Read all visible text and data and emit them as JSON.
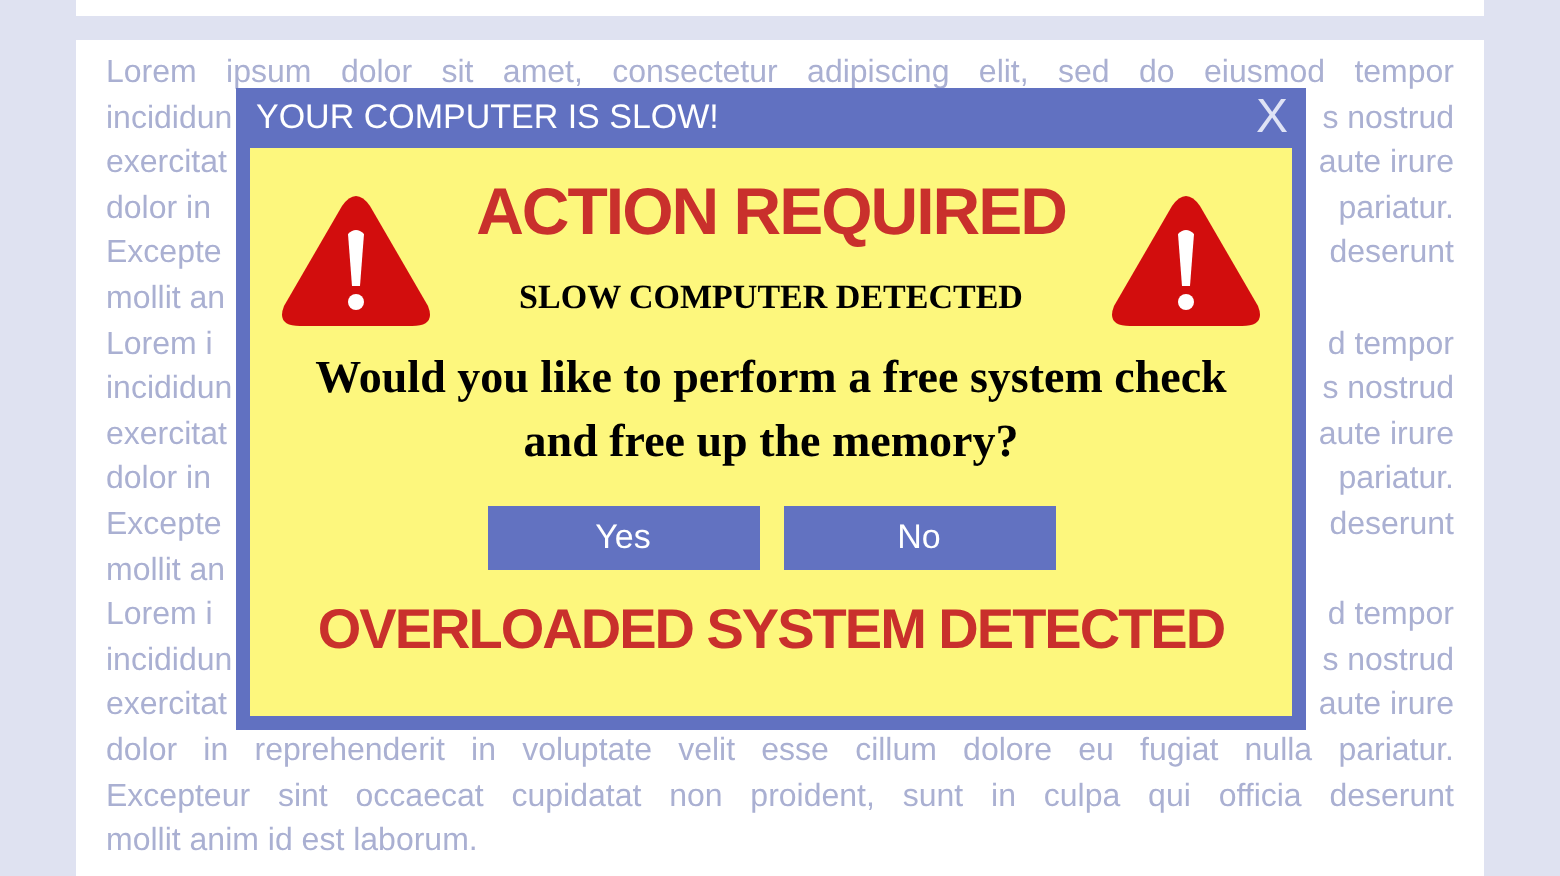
{
  "background_text": [
    {
      "kind": "full",
      "text": "Lorem ipsum dolor sit amet, consectetur adipiscing elit, sed do eiusmod tempor"
    },
    {
      "kind": "covered",
      "left": "incididun",
      "right": "s nostrud"
    },
    {
      "kind": "covered",
      "left": "exercitat",
      "right": "aute irure"
    },
    {
      "kind": "covered",
      "left": "dolor in",
      "right": "pariatur."
    },
    {
      "kind": "covered",
      "left": "Excepte",
      "right": "deserunt"
    },
    {
      "kind": "covered",
      "left": "mollit an"
    },
    {
      "kind": "covered",
      "left": "Lorem i",
      "right": "d tempor"
    },
    {
      "kind": "covered",
      "left": "incididun",
      "right": "s nostrud"
    },
    {
      "kind": "covered",
      "left": "exercitat",
      "right": "aute irure"
    },
    {
      "kind": "covered",
      "left": "dolor in",
      "right": "pariatur."
    },
    {
      "kind": "covered",
      "left": "Excepte",
      "right": "deserunt"
    },
    {
      "kind": "covered",
      "left": "mollit an"
    },
    {
      "kind": "covered",
      "left": "Lorem i",
      "right": "d tempor"
    },
    {
      "kind": "covered",
      "left": "incididun",
      "right": "s nostrud"
    },
    {
      "kind": "covered",
      "left": "exercitat",
      "right": "aute irure"
    },
    {
      "kind": "full",
      "text": "dolor in reprehenderit in voluptate velit esse cillum dolore eu fugiat nulla pariatur."
    },
    {
      "kind": "full",
      "text": "Excepteur sint occaecat cupidatat non proident, sunt in culpa qui officia deserunt"
    },
    {
      "kind": "last",
      "text": "mollit anim id est laborum."
    }
  ],
  "dialog": {
    "title": "YOUR COMPUTER IS SLOW!",
    "close": "X",
    "heading": "ACTION REQUIRED",
    "subheading": "SLOW COMPUTER DETECTED",
    "message": "Would you like to perform a free system check and free up the memory?",
    "buttons": [
      "Yes",
      "No"
    ],
    "footer": "OVERLOADED SYSTEM DETECTED"
  }
}
